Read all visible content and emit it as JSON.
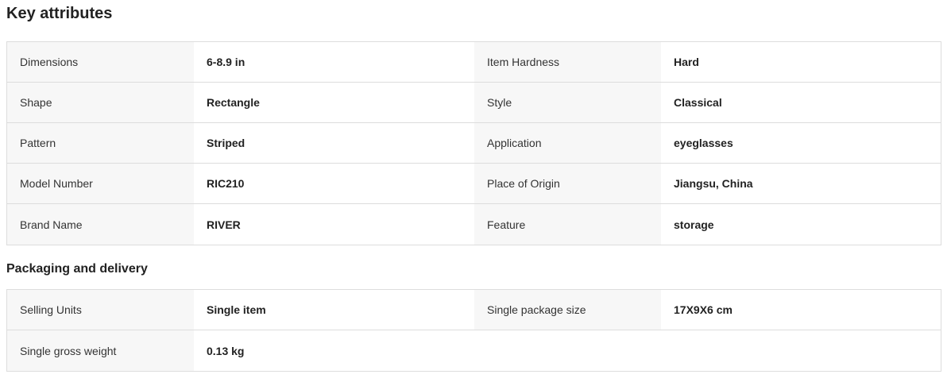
{
  "key_attributes": {
    "title": "Key attributes",
    "rows": [
      {
        "l1": "Dimensions",
        "v1": "6-8.9 in",
        "l2": "Item Hardness",
        "v2": "Hard"
      },
      {
        "l1": "Shape",
        "v1": "Rectangle",
        "l2": "Style",
        "v2": "Classical"
      },
      {
        "l1": "Pattern",
        "v1": "Striped",
        "l2": "Application",
        "v2": "eyeglasses"
      },
      {
        "l1": "Model Number",
        "v1": "RIC210",
        "l2": "Place of Origin",
        "v2": "Jiangsu, China"
      },
      {
        "l1": "Brand Name",
        "v1": "RIVER",
        "l2": "Feature",
        "v2": "storage"
      }
    ]
  },
  "packaging": {
    "title": "Packaging and delivery",
    "rows": [
      {
        "l1": "Selling Units",
        "v1": "Single item",
        "l2": "Single package size",
        "v2": "17X9X6 cm"
      },
      {
        "l1": "Single gross weight",
        "v1": "0.13 kg"
      }
    ]
  }
}
